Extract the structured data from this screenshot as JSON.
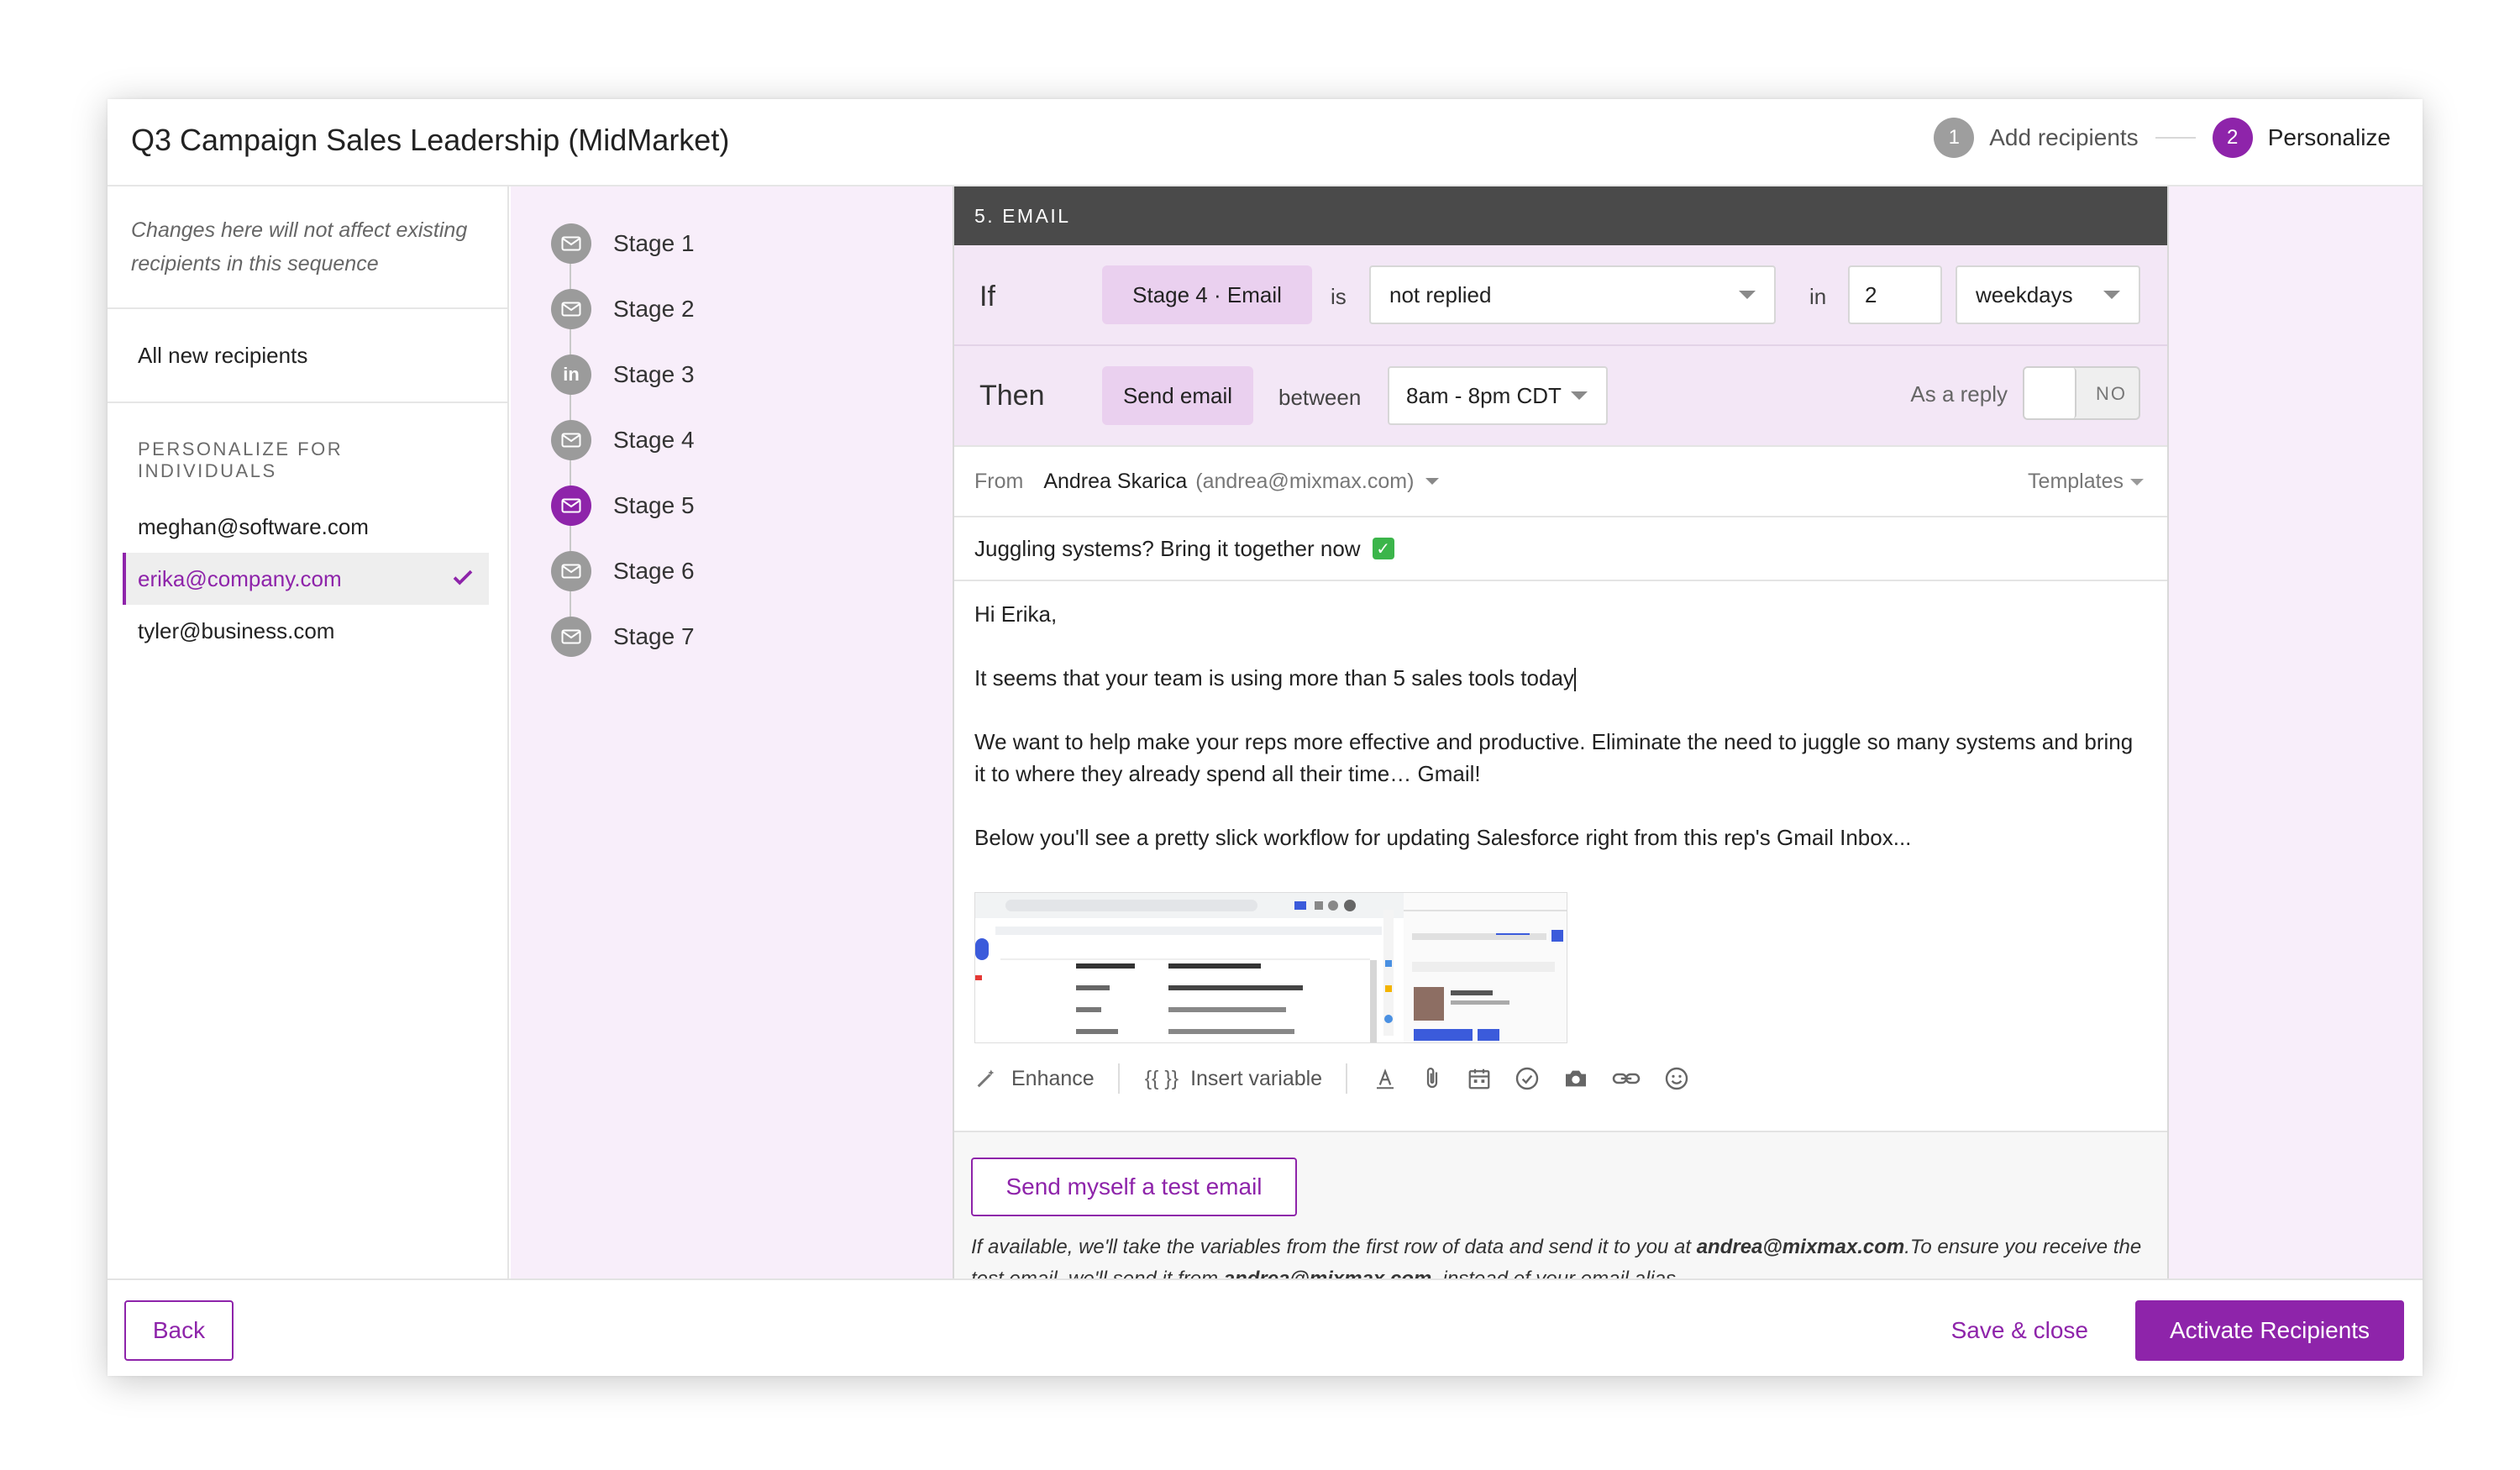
{
  "header": {
    "title": "Q3 Campaign Sales Leadership (MidMarket)",
    "steps": [
      {
        "num": "1",
        "label": "Add recipients"
      },
      {
        "num": "2",
        "label": "Personalize"
      }
    ]
  },
  "sidebar": {
    "note": "Changes here will not affect existing recipients in this sequence",
    "all_label": "All new recipients",
    "section_heading": "PERSONALIZE FOR INDIVIDUALS",
    "recipients": [
      "meghan@software.com",
      "erika@company.com",
      "tyler@business.com"
    ],
    "selected": "erika@company.com"
  },
  "stages": [
    {
      "label": "Stage 1",
      "icon": "mail-icon"
    },
    {
      "label": "Stage 2",
      "icon": "mail-icon"
    },
    {
      "label": "Stage 3",
      "icon": "linkedin-icon"
    },
    {
      "label": "Stage 4",
      "icon": "mail-icon"
    },
    {
      "label": "Stage 5",
      "icon": "mail-icon",
      "active": true
    },
    {
      "label": "Stage 6",
      "icon": "mail-icon"
    },
    {
      "label": "Stage 7",
      "icon": "mail-icon"
    }
  ],
  "panel": {
    "header": "5. EMAIL",
    "if_row": {
      "if_label": "If",
      "stage_pill": "Stage 4  ·  Email",
      "is_label": "is",
      "condition": "not replied",
      "in_label": "in",
      "count": "2",
      "unit": "weekdays"
    },
    "then_row": {
      "then_label": "Then",
      "action": "Send email",
      "between_label": "between",
      "window": "8am - 8pm CDT",
      "reply_label": "As a reply",
      "reply_toggle": "NO"
    },
    "from_label": "From",
    "from_name": "Andrea Skarica",
    "from_email": "(andrea@mixmax.com)",
    "templates_label": "Templates",
    "subject": "Juggling systems? Bring it together now",
    "body": {
      "greeting": "Hi Erika,",
      "p1": "It seems that your team is using more than 5 sales tools today",
      "p2": "We want to help make your reps more effective and productive. Eliminate the need to juggle so many systems and bring it to where they already spend all their time… Gmail!",
      "p3": "Below you'll see a pretty slick workflow for updating Salesforce right from this rep's Gmail Inbox..."
    },
    "toolbar": {
      "enhance": "Enhance",
      "insert_variable": "Insert variable",
      "variable_glyph": "{{ }}"
    },
    "test_button": "Send myself a test email",
    "test_note_a": "If available, we'll take the variables from the first row of data and send it to you at ",
    "test_note_email": "andrea@mixmax.com",
    "test_note_b": ".To ensure you receive the test email, we'll send it from ",
    "test_note_email2": "andrea@mixmax.com",
    "test_note_c": ", instead of your email alias."
  },
  "footer": {
    "back": "Back",
    "save": "Save & close",
    "activate": "Activate Recipients"
  },
  "colors": {
    "accent": "#8e24aa",
    "panel_header": "#4a4a4a",
    "lavender_bg": "#f8eefa"
  }
}
